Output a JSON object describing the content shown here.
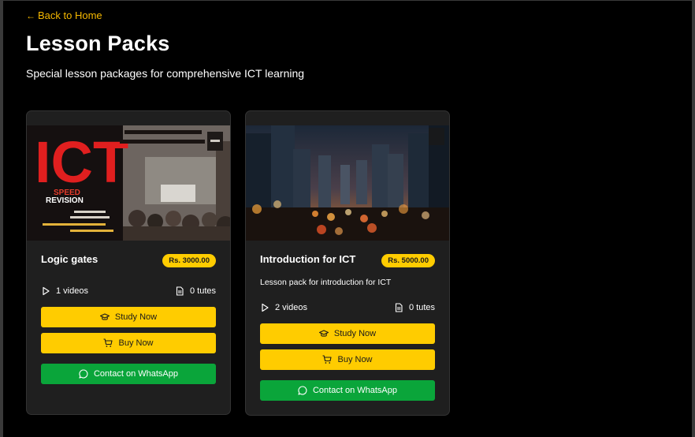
{
  "header": {
    "back_label": "Back to Home",
    "title": "Lesson Packs",
    "subtitle": "Special lesson packages for comprehensive ICT learning"
  },
  "colors": {
    "accent": "#ffcc00",
    "whatsapp": "#0aa53a",
    "card_bg": "#1f1f1f"
  },
  "cards": [
    {
      "title": "Logic gates",
      "price": "Rs. 3000.00",
      "description": "",
      "videos": "1 videos",
      "tutes": "0 tutes",
      "study_label": "Study Now",
      "buy_label": "Buy Now",
      "whatsapp_label": "Contact on WhatsApp",
      "thumbnail": {
        "big_text": "ICT",
        "speed_text": "SPEED",
        "revision_text": "REVISION"
      }
    },
    {
      "title": "Introduction for ICT",
      "price": "Rs. 5000.00",
      "description": "Lesson pack for introduction for ICT",
      "videos": "2 videos",
      "tutes": "0 tutes",
      "study_label": "Study Now",
      "buy_label": "Buy Now",
      "whatsapp_label": "Contact on WhatsApp"
    }
  ]
}
